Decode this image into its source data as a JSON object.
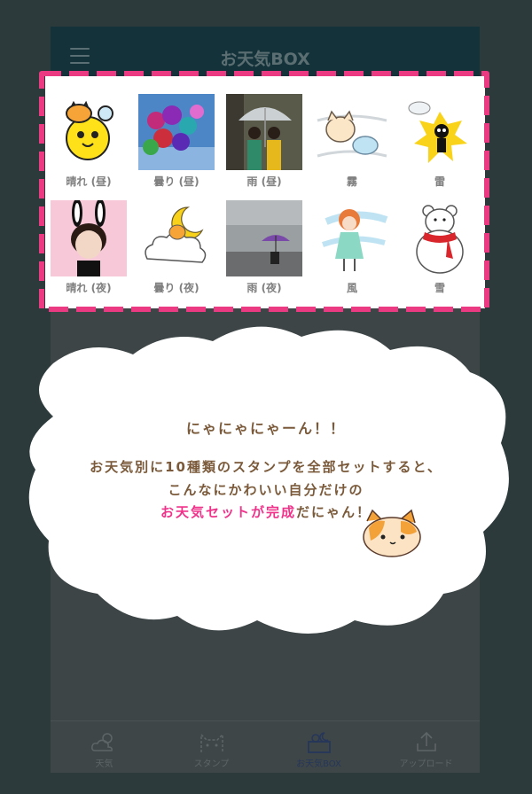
{
  "app": {
    "title": "お天気BOX"
  },
  "stamps": [
    {
      "label": "晴れ (昼)",
      "icon": "sun-cat-sticker"
    },
    {
      "label": "曇り (昼)",
      "icon": "balloons-photo"
    },
    {
      "label": "雨 (昼)",
      "icon": "umbrella-kids-photo"
    },
    {
      "label": "霧",
      "icon": "fog-cat-sticker"
    },
    {
      "label": "雷",
      "icon": "thunder-skeleton-sticker"
    },
    {
      "label": "晴れ (夜)",
      "icon": "bunny-girl-photo"
    },
    {
      "label": "曇り (夜)",
      "icon": "moon-cloud-cat-sticker"
    },
    {
      "label": "雨 (夜)",
      "icon": "purple-umbrella-photo"
    },
    {
      "label": "風",
      "icon": "windy-girl-sticker"
    },
    {
      "label": "雪",
      "icon": "polar-bear-sticker"
    }
  ],
  "message": {
    "line1": "にゃにゃにゃーん！！",
    "line2": "お天気別に10種類のスタンプを全部セットすると、",
    "line3": "こんなにかわいい自分だけの",
    "line4_pink": "お天気セットが完成",
    "line4_rest": "だにゃん！"
  },
  "tabs": [
    {
      "label": "天気",
      "icon": "sun-cloud-icon"
    },
    {
      "label": "スタンプ",
      "icon": "cat-face-icon"
    },
    {
      "label": "お天気BOX",
      "icon": "weather-box-icon"
    },
    {
      "label": "アップロード",
      "icon": "upload-icon"
    }
  ],
  "colors": {
    "highlight_border": "#ec3a82",
    "accent_pink": "#f0338a",
    "message_brown": "#7a5a3a"
  }
}
